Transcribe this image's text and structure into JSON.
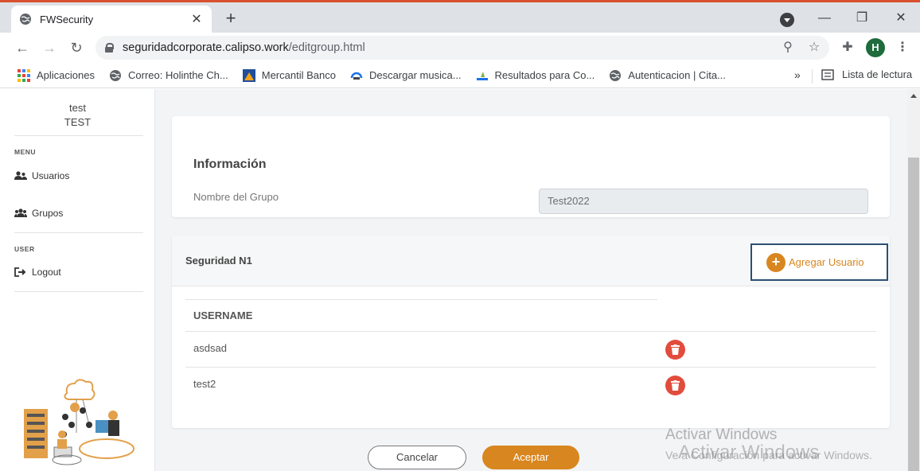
{
  "browser": {
    "tab_title": "FWSecurity",
    "url_host": "seguridadcorporate.calipso.work",
    "url_path": "/editgroup.html",
    "profile_initial": "H",
    "bookmarks": [
      {
        "label": "Aplicaciones",
        "icon": "apps-icon"
      },
      {
        "label": "Correo: Holinthe Ch...",
        "icon": "globe-icon"
      },
      {
        "label": "Mercantil Banco",
        "icon": "bank-icon"
      },
      {
        "label": "Descargar musica...",
        "icon": "music-icon"
      },
      {
        "label": "Resultados para Co...",
        "icon": "search-result-icon"
      },
      {
        "label": "Autenticacion | Cita...",
        "icon": "globe-icon"
      }
    ],
    "bookmarks_more": "»",
    "reading_list": "Lista de lectura"
  },
  "sidebar": {
    "user_name": "test",
    "user_role": "TEST",
    "menu_heading": "MENU",
    "menu_items": [
      {
        "label": "Usuarios",
        "icon": "users-icon"
      },
      {
        "label": "Grupos",
        "icon": "group-icon"
      }
    ],
    "user_heading": "USER",
    "user_items": [
      {
        "label": "Logout",
        "icon": "logout-icon"
      }
    ]
  },
  "info_card": {
    "title": "Información",
    "field_label": "Nombre del Grupo",
    "field_value": "Test2022"
  },
  "security_card": {
    "title": "Seguridad N1",
    "add_button": "Agregar Usuario",
    "column_header": "USERNAME",
    "rows": [
      {
        "username": "asdsad"
      },
      {
        "username": "test2"
      }
    ]
  },
  "actions": {
    "cancel": "Cancelar",
    "accept": "Aceptar"
  },
  "watermark": {
    "line1": "Activar Windows",
    "line2": "Ve a Configuración para activar Windows.",
    "overlay": "Activar Windows"
  },
  "colors": {
    "accent": "#d8861f",
    "delete": "#e24c3d",
    "button_border": "#2c4f73"
  }
}
